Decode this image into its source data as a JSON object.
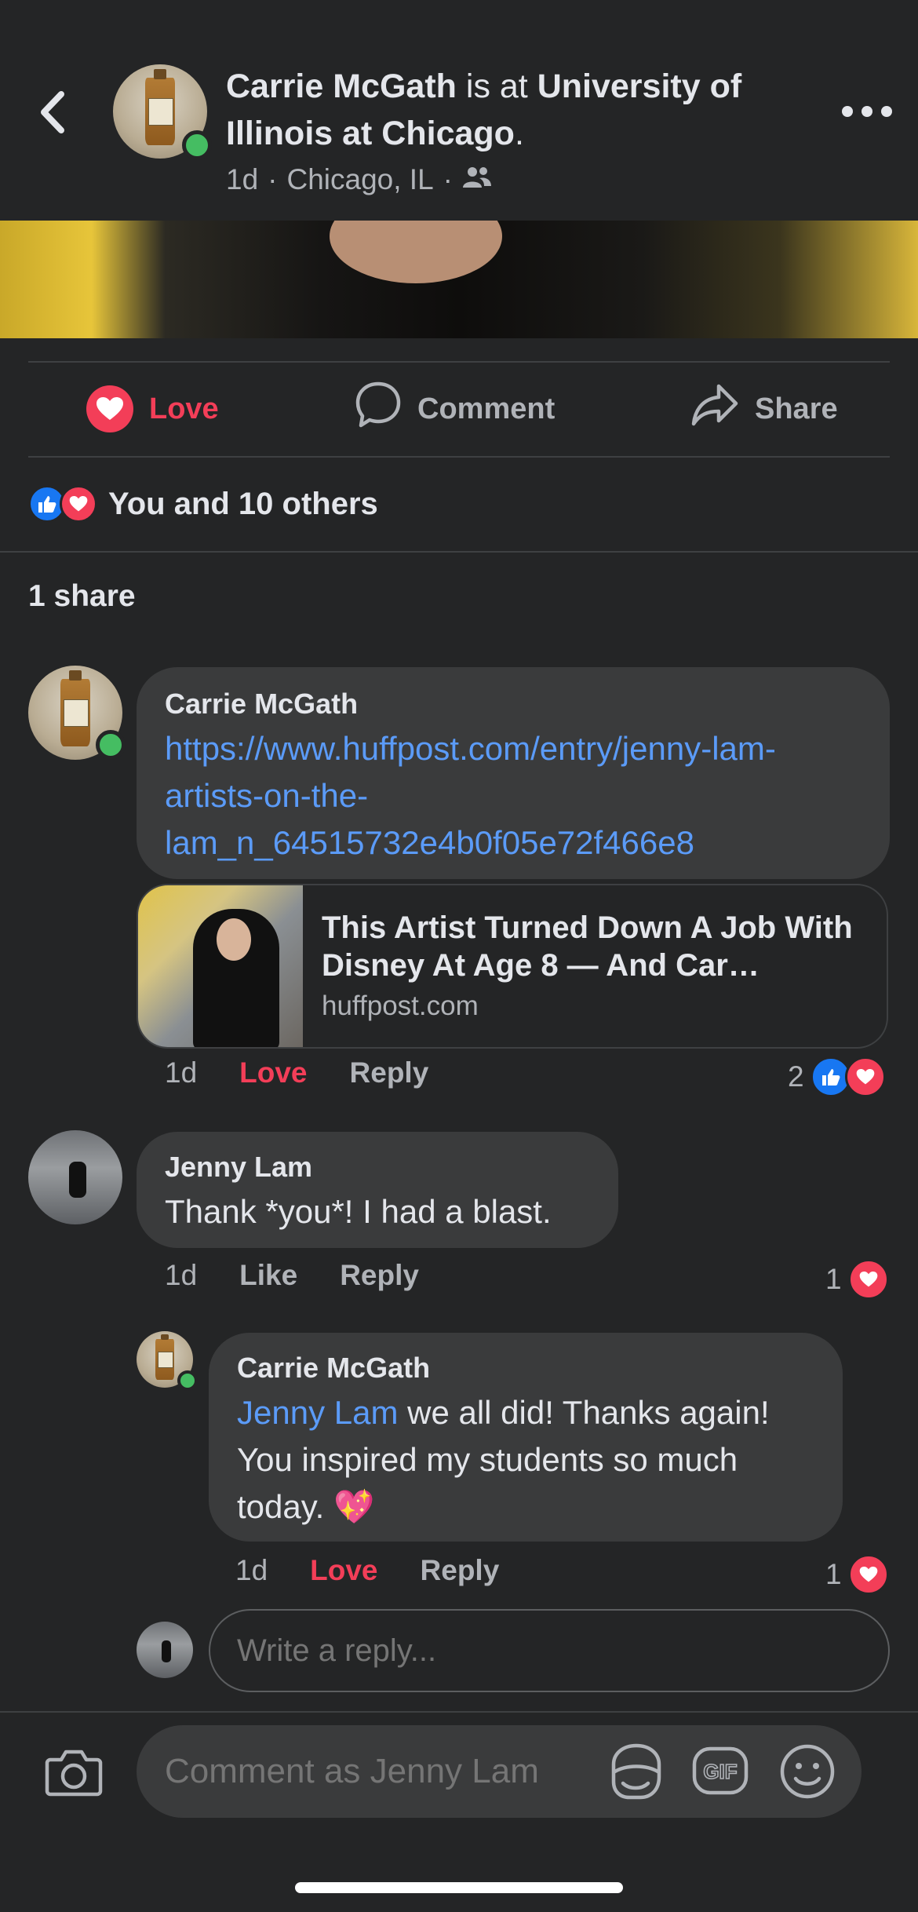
{
  "header": {
    "author": "Carrie McGath",
    "is_at": " is at ",
    "place": "University of Illinois at Chicago",
    "period": ".",
    "time": "1d",
    "sep": "·",
    "location": "Chicago, IL",
    "audience_icon": "friends-icon"
  },
  "actions": {
    "love_label": "Love",
    "comment_label": "Comment",
    "share_label": "Share"
  },
  "reactions": {
    "summary": "You and 10 others",
    "icons": [
      "like-icon",
      "love-icon"
    ]
  },
  "shares": {
    "label": "1 share"
  },
  "comments": [
    {
      "author": "Carrie McGath",
      "link_text": "https://www.huffpost.com/entry/jenny-lam-artists-on-the-lam_n_64515732e4b0f05e72f466e8",
      "link_line1": "https://www.huffpost.com/entry/jenny-lam-",
      "link_line2": "artists-on-the-",
      "link_line3": "lam_n_64515732e4b0f05e72f466e8",
      "preview": {
        "title": "This Artist Turned Down A Job With Disney At Age 8 — And Car…",
        "domain": "huffpost.com"
      },
      "time": "1d",
      "reaction_label": "Love",
      "reply_label": "Reply",
      "reaction_count": "2"
    },
    {
      "author": "Jenny Lam",
      "text": "Thank *you*! I had a blast.",
      "time": "1d",
      "reaction_label": "Like",
      "reply_label": "Reply",
      "reaction_count": "1"
    },
    {
      "author": "Carrie McGath",
      "mention": "Jenny Lam",
      "text": " we all did! Thanks again! You inspired my students so much today. 💖",
      "time": "1d",
      "reaction_label": "Love",
      "reply_label": "Reply",
      "reaction_count": "1"
    }
  ],
  "reply_box": {
    "placeholder": "Write a reply..."
  },
  "composer": {
    "placeholder": "Comment as Jenny Lam",
    "gif_label": "GIF"
  },
  "colors": {
    "background": "#242526",
    "bubble": "#3a3b3c",
    "love": "#f33e58",
    "like": "#1877f2",
    "link": "#5b9bf8",
    "online": "#45bd62"
  }
}
